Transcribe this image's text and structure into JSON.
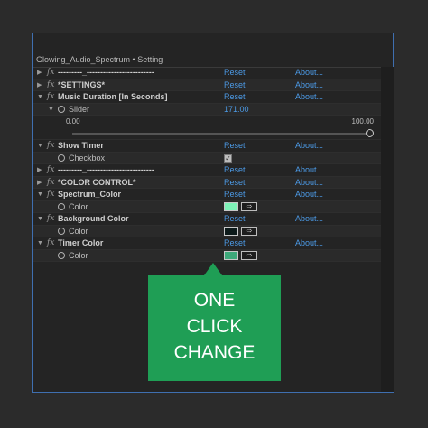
{
  "panel": {
    "title": "Glowing_Audio_Spectrum • Setting"
  },
  "rows": [
    {
      "type": "effect",
      "name": "---------_-------------------------",
      "reset": "Reset",
      "about": "About..."
    },
    {
      "type": "effect",
      "name": "*SETTINGS*",
      "reset": "Reset",
      "about": "About..."
    },
    {
      "type": "effect",
      "name": "Music Duration [In Seconds]",
      "reset": "Reset",
      "about": "About..."
    },
    {
      "type": "param",
      "label": "Slider",
      "value": "171.00"
    },
    {
      "type": "slider",
      "min": "0.00",
      "max": "100.00"
    },
    {
      "type": "effect",
      "name": "Show Timer",
      "reset": "Reset",
      "about": "About..."
    },
    {
      "type": "checkbox",
      "label": "Checkbox",
      "checked": true
    },
    {
      "type": "effect",
      "name": "---------_-------------------------",
      "reset": "Reset",
      "about": "About..."
    },
    {
      "type": "effect",
      "name": "*COLOR CONTROL*",
      "reset": "Reset",
      "about": "About..."
    },
    {
      "type": "effect",
      "name": "Spectrum_Color",
      "reset": "Reset",
      "about": "About..."
    },
    {
      "type": "color",
      "label": "Color",
      "swatch": "#7ef2b8"
    },
    {
      "type": "effect",
      "name": "Background Color",
      "reset": "Reset",
      "about": "About..."
    },
    {
      "type": "color",
      "label": "Color",
      "swatch": "#0d1a1a"
    },
    {
      "type": "effect",
      "name": "Timer Color",
      "reset": "Reset",
      "about": "About..."
    },
    {
      "type": "color",
      "label": "Color",
      "swatch": "#3ea87a"
    }
  ],
  "callout": {
    "line1": "ONE",
    "line2": "CLICK",
    "line3": "CHANGE",
    "color": "#1f9e55"
  },
  "icons": {
    "twirl_open": "▼",
    "twirl_closed": "▶",
    "fx": "fx",
    "checkmark": "✓",
    "eyedropper": "⇨"
  },
  "colors": {
    "link": "#4c9ae6",
    "panel_border": "#3f6fb0"
  }
}
